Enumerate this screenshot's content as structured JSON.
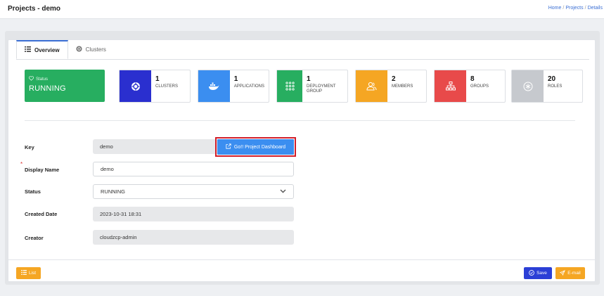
{
  "header": {
    "title": "Projects - demo",
    "breadcrumb": [
      "Home",
      "Projects",
      "Details"
    ]
  },
  "tabs": [
    {
      "label": "Overview",
      "active": true
    },
    {
      "label": "Clusters",
      "active": false
    }
  ],
  "status": {
    "label": "Status",
    "value": "RUNNING",
    "color": "#27ae60"
  },
  "stats": [
    {
      "count": "1",
      "name": "CLUSTERS",
      "color": "#2a2fcf",
      "icon": "helm-icon"
    },
    {
      "count": "1",
      "name": "APPLICATIONS",
      "color": "#3b8ef0",
      "icon": "docker-icon"
    },
    {
      "count": "1",
      "name": "DEPLOYMENT GROUP",
      "color": "#27ae60",
      "icon": "grid-icon"
    },
    {
      "count": "2",
      "name": "MEMBERS",
      "color": "#f5a623",
      "icon": "users-icon"
    },
    {
      "count": "8",
      "name": "GROUPS",
      "color": "#e84a4a",
      "icon": "hierarchy-icon"
    },
    {
      "count": "20",
      "name": "ROLES",
      "color": "#c6c9ce",
      "icon": "asterisk-icon"
    }
  ],
  "form": {
    "key_label": "Key",
    "key_value": "demo",
    "go_button": "Go!! Project Dashboard",
    "display_name_label": "Display Name",
    "display_name_value": "demo",
    "status_label": "Status",
    "status_value": "RUNNING",
    "created_label": "Created Date",
    "created_value": "2023-10-31 18:31",
    "creator_label": "Creator",
    "creator_value": "cloudzcp-admin"
  },
  "footer": {
    "list_label": "List",
    "save_label": "Save",
    "email_label": "E-mail"
  }
}
